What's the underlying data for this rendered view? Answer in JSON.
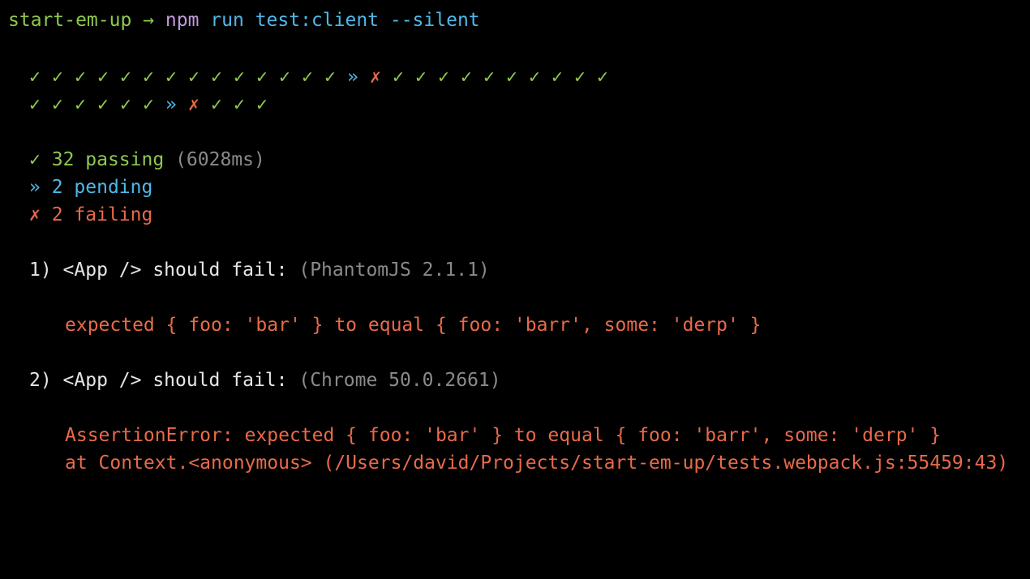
{
  "colors": {
    "green": "#8fc84f",
    "blue": "#4fb8e8",
    "red": "#e86a4a",
    "purple": "#c39bdb",
    "gray": "#8a8a8a",
    "white": "#e6e6e6",
    "background": "#000000"
  },
  "prompt": {
    "cwd": "start-em-up",
    "arrow": "→",
    "command": "npm",
    "args": "run test:client --silent"
  },
  "progress": {
    "row1": [
      "✓",
      "✓",
      "✓",
      "✓",
      "✓",
      "✓",
      "✓",
      "✓",
      "✓",
      "✓",
      "✓",
      "✓",
      "✓",
      "✓",
      "»",
      "✗",
      "✓",
      "✓",
      "✓",
      "✓",
      "✓",
      "✓",
      "✓",
      "✓",
      "✓",
      "✓"
    ],
    "row2": [
      "✓",
      "✓",
      "✓",
      "✓",
      "✓",
      "✓",
      "»",
      "✗",
      "✓",
      "✓",
      "✓"
    ]
  },
  "summary": {
    "passing_icon": "✓",
    "passing_text": "32 passing",
    "passing_time": "(6028ms)",
    "pending_icon": "»",
    "pending_text": "2 pending",
    "failing_icon": "✗",
    "failing_text": "2 failing"
  },
  "failures": [
    {
      "title": "1) <App /> should fail:",
      "env": "(PhantomJS 2.1.1)",
      "messages": [
        "expected { foo: 'bar' } to equal { foo: 'barr', some: 'derp' }"
      ]
    },
    {
      "title": "2) <App /> should fail:",
      "env": "(Chrome 50.0.2661)",
      "messages": [
        "AssertionError: expected { foo: 'bar' } to equal { foo: 'barr', some: 'derp' }",
        "at Context.<anonymous> (/Users/david/Projects/start-em-up/tests.webpack.js:55459:43)"
      ]
    }
  ]
}
